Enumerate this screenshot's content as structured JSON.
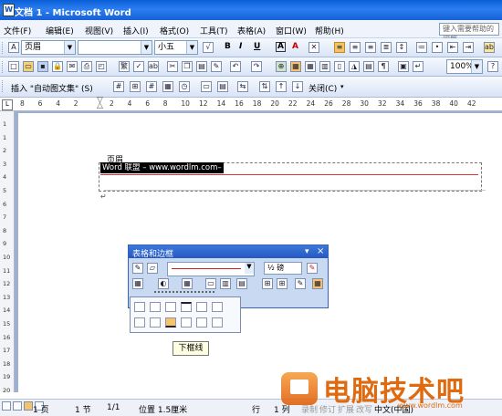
{
  "window": {
    "title": "文档 1 - Microsoft Word",
    "logo": "W"
  },
  "menubar": {
    "items": [
      "文件(F)",
      "编辑(E)",
      "视图(V)",
      "插入(I)",
      "格式(O)",
      "工具(T)",
      "表格(A)",
      "窗口(W)",
      "帮助(H)"
    ],
    "ask_placeholder": "键入需要帮助的问题"
  },
  "formatting": {
    "style": "页眉",
    "font": "",
    "size": "小五",
    "bold": "B",
    "italic": "I",
    "underline": "U",
    "font_color": "A",
    "char_border": "A"
  },
  "standard": {
    "zoom": "100%"
  },
  "header_toolbar": {
    "insert_autotext": "插入 \"自动图文集\" (S)",
    "close": "关闭(C)"
  },
  "ruler": {
    "numbers": [
      "8",
      "6",
      "4",
      "2",
      "",
      "2",
      "4",
      "6",
      "8",
      "10",
      "12",
      "14",
      "16",
      "18",
      "20",
      "22",
      "24",
      "26",
      "28",
      "30",
      "32",
      "34",
      "36",
      "38",
      "40",
      "42"
    ]
  },
  "vruler": {
    "numbers": [
      "1",
      "",
      "1",
      "",
      "2",
      "",
      "3",
      "",
      "4",
      "",
      "5",
      "",
      "6",
      "",
      "7",
      "",
      "8",
      "",
      "9",
      "",
      "10",
      "",
      "11",
      "",
      "12",
      "",
      "13",
      "",
      "14",
      "",
      "15",
      "",
      "16",
      "",
      "17",
      "",
      "18",
      "",
      "19",
      "",
      "20"
    ]
  },
  "document": {
    "header_label": "页眉",
    "header_text": "Word 联盟 – www.wordlm.com–",
    "para_mark": "↵"
  },
  "tables_panel": {
    "title": "表格和边框",
    "line_weight": "½ 磅",
    "close": "×",
    "dropdown": "▾"
  },
  "tooltip": {
    "text": "下框线"
  },
  "statusbar": {
    "page": "1 页",
    "section": "1 节",
    "pages": "1/1",
    "position": "位置 1.5厘米",
    "line": "行",
    "column": "1 列",
    "modes": [
      "录制",
      "修订",
      "扩展",
      "改写"
    ],
    "lang": "中文(中国)"
  },
  "watermark": {
    "text": "电脑技术吧",
    "url": "www.wordlm.com"
  }
}
